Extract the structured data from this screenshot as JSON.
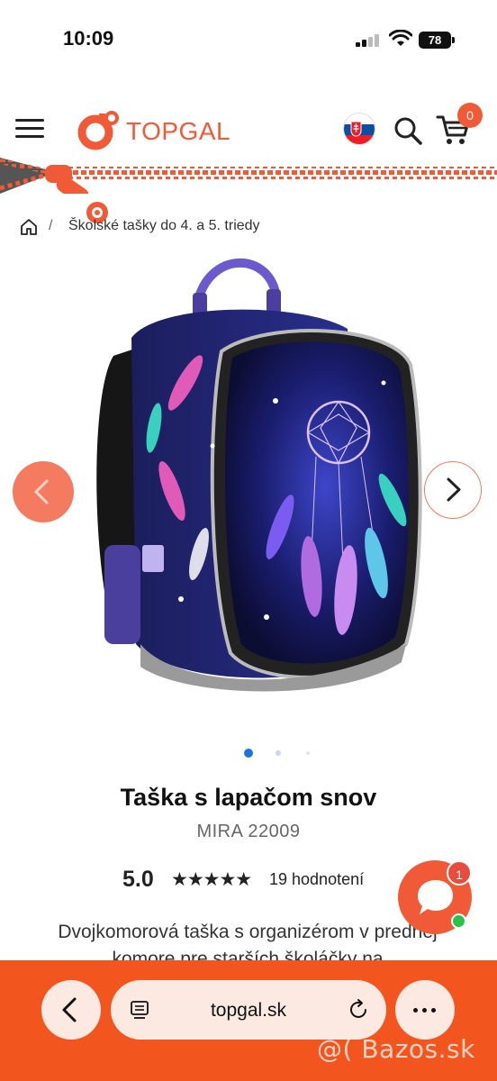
{
  "status_bar": {
    "time": "10:09",
    "battery": "78"
  },
  "header": {
    "brand": "TOPGAL",
    "cart_count": "0"
  },
  "breadcrumb": {
    "separator": "/",
    "current": "Školské tašky do 4. a 5. triedy"
  },
  "product": {
    "title": "Taška s lapačom snov",
    "code": "MIRA 22009",
    "rating": "5.0",
    "stars": "★★★★★",
    "reviews": "19 hodnotení",
    "description": "Dvojkomorová taška s organizérom v prednej komore pre starších školáčky na"
  },
  "gallery": {
    "slide_count": 3,
    "active_index": 0
  },
  "chat": {
    "badge": "1"
  },
  "browser": {
    "url": "topgal.sk"
  },
  "watermark": "@( Bazos.sk",
  "colors": {
    "brand": "#f15a36",
    "browser_bar": "#f2551d",
    "dot_active": "#1a73e8"
  }
}
